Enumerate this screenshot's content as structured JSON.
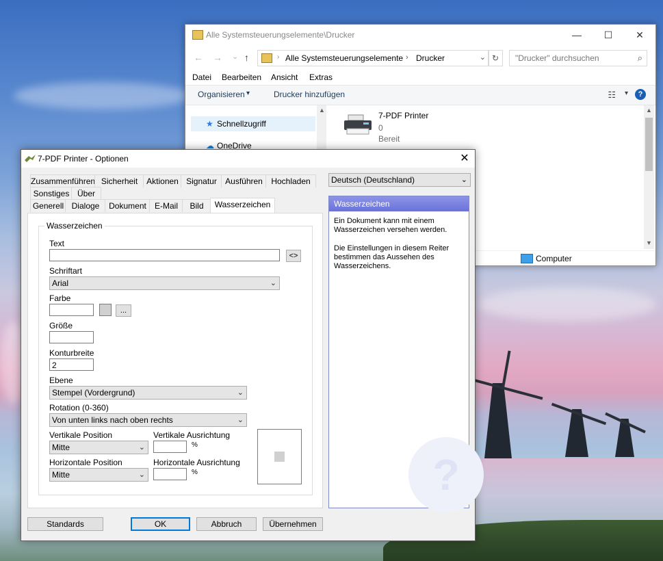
{
  "explorer": {
    "title": "Alle Systemsteuerungselemente\\Drucker",
    "address": {
      "root": "Alle Systemsteuerungselemente",
      "current": "Drucker",
      "sep": "›"
    },
    "search_placeholder": "\"Drucker\" durchsuchen",
    "menu": [
      "Datei",
      "Bearbeiten",
      "Ansicht",
      "Extras"
    ],
    "commands": {
      "organize": "Organisieren",
      "organize_arrow": "▾",
      "add_printer": "Drucker hinzufügen"
    },
    "sidebar": [
      {
        "label": "Schnellzugriff",
        "icon": "star-icon"
      },
      {
        "label": "OneDrive",
        "icon": "cloud-icon"
      }
    ],
    "printer": {
      "name": "7-PDF Printer",
      "jobs": "0",
      "status": "Bereit"
    },
    "status_item": "Computer",
    "window_controls": {
      "minimize": "—",
      "maximize": "☐",
      "close": "✕"
    },
    "nav": {
      "back": "←",
      "forward": "→",
      "recent": "⌄",
      "up": "↑"
    },
    "help": "?",
    "view_glyph": "☷",
    "view_drop": "▾",
    "refresh": "↻",
    "search_glyph": "⌕",
    "addr_drop": "⌄",
    "scroll_up": "▲",
    "scroll_down": "▼",
    "star_glyph": "★",
    "cloud_glyph": "☁"
  },
  "dialog": {
    "title": "7-PDF Printer - Optionen",
    "close": "✕",
    "tabs_row1": [
      "Zusammenführen",
      "Sicherheit",
      "Aktionen",
      "Signatur",
      "Ausführen",
      "Hochladen"
    ],
    "tabs_row2": [
      "Sonstiges",
      "Über"
    ],
    "tabs_row3": [
      "Generell",
      "Dialoge",
      "Dokument",
      "E-Mail",
      "Bild",
      "Wasserzeichen"
    ],
    "active_tab": "Wasserzeichen",
    "language": "Deutsch (Deutschland)",
    "group_title": "Wasserzeichen",
    "fields": {
      "text_label": "Text",
      "text_value": "",
      "text_btn": "<>",
      "font_label": "Schriftart",
      "font_value": "Arial",
      "color_label": "Farbe",
      "color_value": "",
      "color_btn": "...",
      "size_label": "Größe",
      "size_value": "",
      "outline_label": "Konturbreite",
      "outline_value": "2",
      "layer_label": "Ebene",
      "layer_value": "Stempel (Vordergrund)",
      "rotation_label": "Rotation (0-360)",
      "rotation_value": "Von unten links nach oben rechts",
      "vpos_label": "Vertikale Position",
      "vpos_value": "Mitte",
      "valign_label": "Vertikale Ausrichtung",
      "valign_value": "",
      "valign_unit": "%",
      "hpos_label": "Horizontale Position",
      "hpos_value": "Mitte",
      "halign_label": "Horizontale Ausrichtung",
      "halign_value": "",
      "halign_unit": "%"
    },
    "help": {
      "title": "Wasserzeichen",
      "p1": "Ein Dokument kann mit einem Wasserzeichen versehen werden.",
      "p2": "Die Einstellungen in diesem Reiter bestimmen das Aussehen des Wasserzeichens.",
      "watermark": "?"
    },
    "buttons": {
      "defaults": "Standards",
      "ok": "OK",
      "cancel": "Abbruch",
      "apply": "Übernehmen"
    },
    "chevron": "⌄"
  },
  "colors": {
    "accent": "#0078d7",
    "help_header": "#6a72d9",
    "folder": "#e8c25a"
  }
}
